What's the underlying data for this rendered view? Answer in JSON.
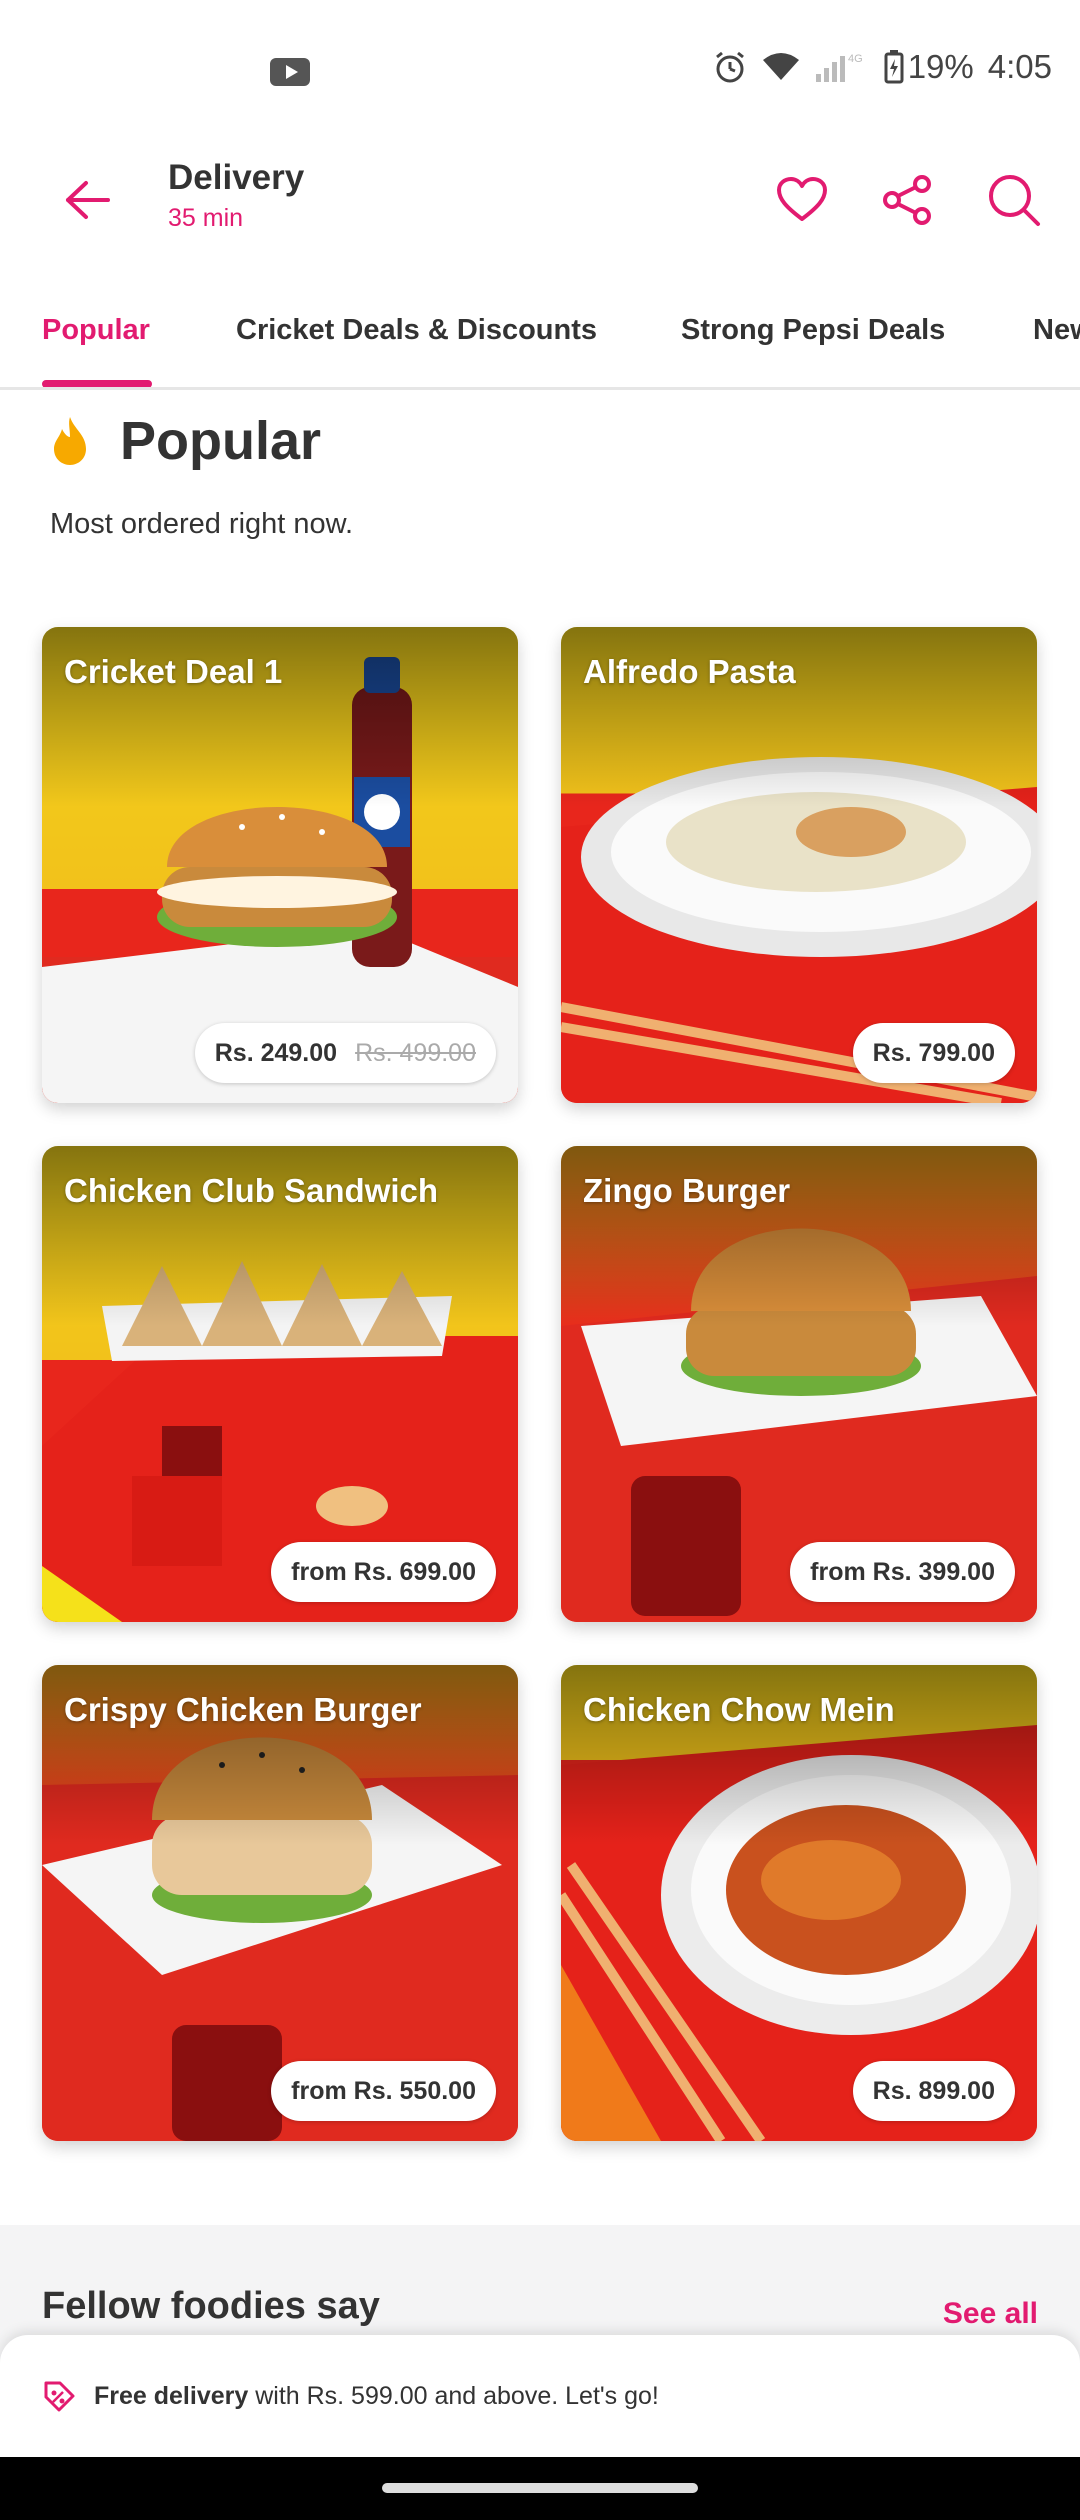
{
  "status_bar": {
    "battery": "19%",
    "time": "4:05",
    "network": "4G"
  },
  "header": {
    "title": "Delivery",
    "subtitle": "35 min"
  },
  "tabs": [
    {
      "label": "Popular",
      "active": true
    },
    {
      "label": "Cricket Deals & Discounts",
      "active": false
    },
    {
      "label": "Strong Pepsi Deals",
      "active": false
    },
    {
      "label": "New",
      "active": false
    }
  ],
  "section": {
    "title": "Popular",
    "subtitle": "Most ordered right now."
  },
  "items": [
    {
      "name": "Cricket Deal 1",
      "price": "Rs. 249.00",
      "old_price": "Rs. 499.00"
    },
    {
      "name": "Alfredo Pasta",
      "price": "Rs. 799.00"
    },
    {
      "name": "Chicken Club Sandwich",
      "price": "from Rs. 699.00"
    },
    {
      "name": "Zingo Burger",
      "price": "from Rs. 399.00"
    },
    {
      "name": "Crispy Chicken Burger",
      "price": "from Rs. 550.00"
    },
    {
      "name": "Chicken Chow Mein",
      "price": "Rs. 899.00"
    }
  ],
  "reviews": {
    "title": "Fellow foodies say",
    "see_all": "See all"
  },
  "banner": {
    "strong": "Free delivery",
    "text": " with Rs. 599.00 and above. Let's go!"
  },
  "colors": {
    "accent": "#e21b70",
    "card_red": "#e8261c",
    "card_yellow": "#f2d31b"
  }
}
